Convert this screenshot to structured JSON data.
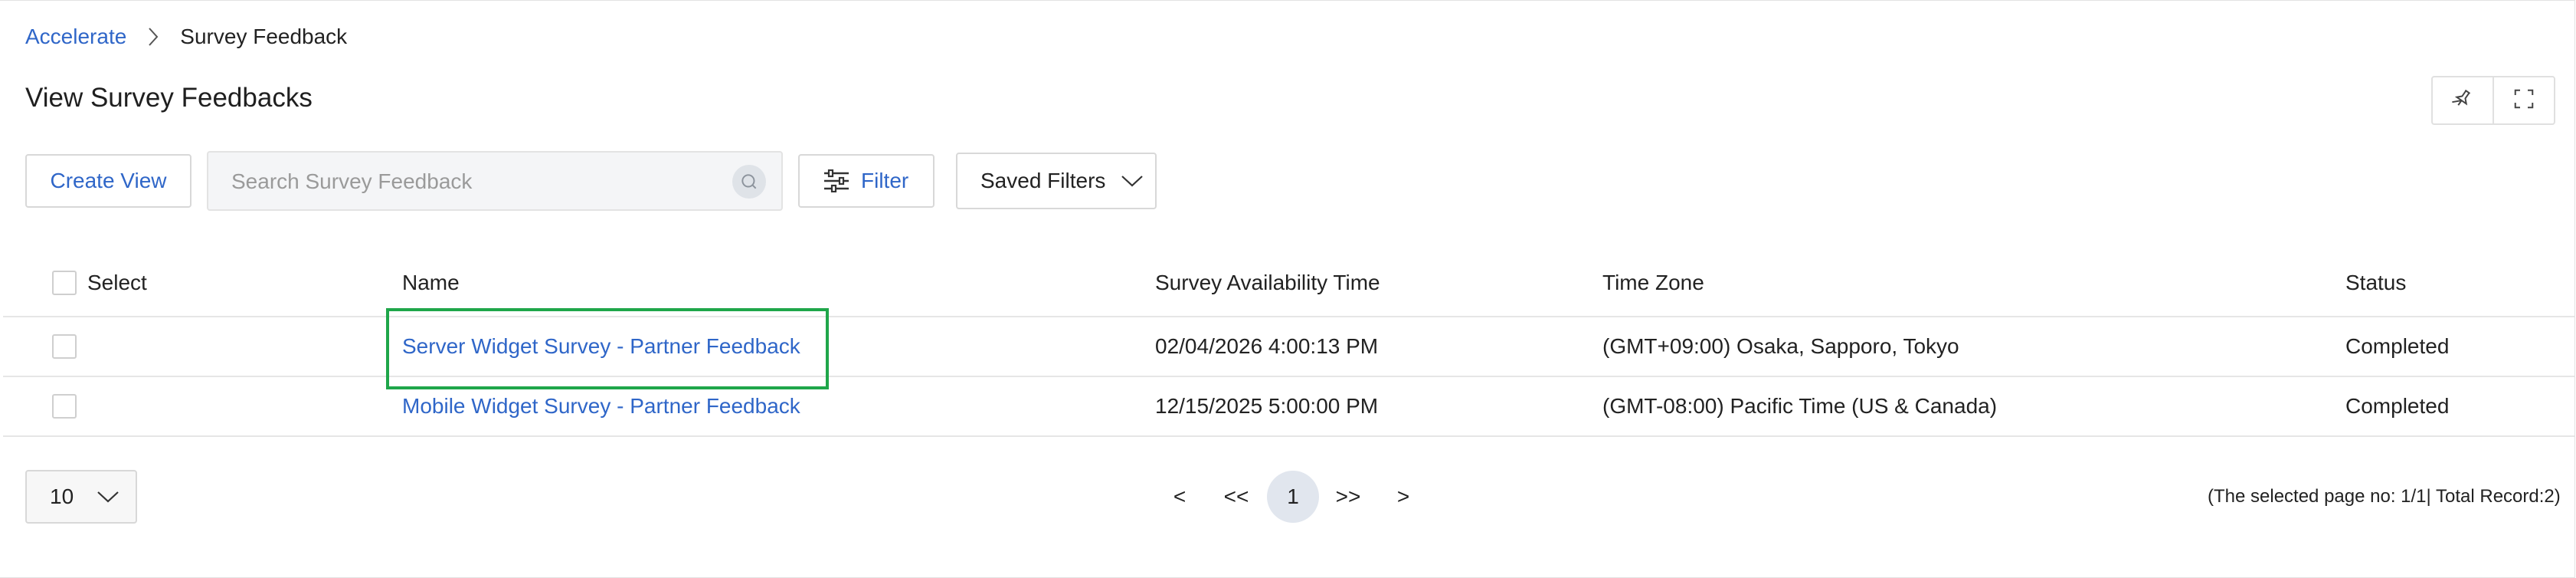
{
  "breadcrumb": {
    "root": "Accelerate",
    "current": "Survey Feedback"
  },
  "page_title": "View Survey Feedbacks",
  "toolbar": {
    "create_view_label": "Create View",
    "search_placeholder": "Search Survey Feedback",
    "filter_label": "Filter",
    "saved_filters_label": "Saved Filters"
  },
  "header_icons": [
    "pin-icon",
    "fullscreen-icon"
  ],
  "table": {
    "columns": {
      "select": "Select",
      "name": "Name",
      "availability": "Survey Availability Time",
      "timezone": "Time Zone",
      "status": "Status"
    },
    "rows": [
      {
        "name": "Server Widget Survey - Partner Feedback",
        "availability": "02/04/2026 4:00:13 PM",
        "timezone": "(GMT+09:00) Osaka, Sapporo, Tokyo",
        "status": "Completed"
      },
      {
        "name": "Mobile Widget Survey - Partner Feedback",
        "availability": "12/15/2025 5:00:00 PM",
        "timezone": "(GMT-08:00) Pacific Time (US & Canada)",
        "status": "Completed"
      }
    ]
  },
  "pagination": {
    "page_size": "10",
    "prev": "<",
    "first": "<<",
    "current": "1",
    "last": ">>",
    "next": ">",
    "info": "(The selected page no: 1/1| Total Record:2)"
  },
  "colors": {
    "link": "#2f66c8",
    "highlight": "#1fa64a"
  }
}
